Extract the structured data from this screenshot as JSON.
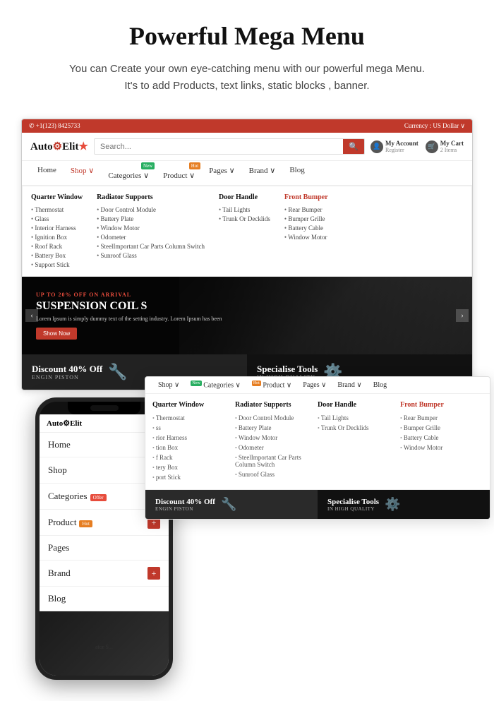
{
  "page": {
    "title": "Powerful Mega Menu",
    "subtitle_line1": "You can Create your own eye-catching menu with our powerful mega Menu.",
    "subtitle_line2": "It's to add Products, text links, static blocks , banner."
  },
  "topbar": {
    "phone": "✆ +1(123) 8425733",
    "currency": "Currency : US Dollar ∨"
  },
  "header": {
    "logo": "AutoElit",
    "search_placeholder": "Search...",
    "search_btn": "🔍",
    "account_label": "My Account",
    "register_label": "Register",
    "cart_label": "My Cart",
    "cart_count": "2 Items"
  },
  "desktop_nav": {
    "items": [
      {
        "label": "Home",
        "badge": ""
      },
      {
        "label": "Shop ∨",
        "badge": ""
      },
      {
        "label": "Categories ∨",
        "badge": "New"
      },
      {
        "label": "Product ∨",
        "badge": "Hot"
      },
      {
        "label": "Pages ∨",
        "badge": ""
      },
      {
        "label": "Brand ∨",
        "badge": ""
      },
      {
        "label": "Blog",
        "badge": ""
      }
    ]
  },
  "mega_menu": {
    "columns": [
      {
        "title": "Quarter Window",
        "title_color": "normal",
        "items": [
          "Thermostat",
          "Glass",
          "Interior Harness",
          "Ignition Box",
          "Roof Rack",
          "Battery Box",
          "Support Stick"
        ]
      },
      {
        "title": "Radiator Supports",
        "title_color": "normal",
        "items": [
          "Door Control Module",
          "Battery Plate",
          "Window Motor",
          "Odometer",
          "SteelImportant Car Parts Column Switch",
          "Sunroof Glass"
        ]
      },
      {
        "title": "Door Handle",
        "title_color": "normal",
        "items": [
          "Tail Lights",
          "Trunk Or Decklids"
        ]
      },
      {
        "title": "Front Bumper",
        "title_color": "red",
        "items": [
          "Rear Bumper",
          "Bumper Grille",
          "Battery Cable",
          "Window Motor"
        ]
      }
    ]
  },
  "hero": {
    "offer": "UP TO 20% OFF ON ARRIVAL",
    "title": "SUSPENSION COIL S",
    "text": "Lorem Ipsum is simply dummy text of the setting industry. Lorem Ipsum has been",
    "btn": "Show Now"
  },
  "promo_banners": [
    {
      "label": "Discount 40% Off",
      "sub": "ENGIN PISTON",
      "icon": "🔧"
    },
    {
      "label": "Specialise Tools",
      "sub": "IN HIGH QUALITY",
      "icon": "⚙️"
    }
  ],
  "mobile_nav": {
    "items": [
      {
        "label": "Home",
        "has_plus": false,
        "badge": ""
      },
      {
        "label": "Shop",
        "has_plus": true,
        "badge": ""
      },
      {
        "label": "Categories",
        "has_plus": true,
        "badge": "Offer"
      },
      {
        "label": "Product",
        "has_plus": true,
        "badge": "Hot"
      },
      {
        "label": "Pages",
        "has_plus": false,
        "badge": ""
      },
      {
        "label": "Brand",
        "has_plus": true,
        "badge": ""
      },
      {
        "label": "Blog",
        "has_plus": false,
        "badge": ""
      }
    ]
  },
  "overlay_nav": {
    "items": [
      {
        "label": "Shop ∨",
        "badge": ""
      },
      {
        "label": "Categories ∨",
        "badge": "New"
      },
      {
        "label": "Product ∨",
        "badge": "Hot"
      },
      {
        "label": "Pages ∨",
        "badge": ""
      },
      {
        "label": "Brand ∨",
        "badge": ""
      },
      {
        "label": "Blog",
        "badge": ""
      }
    ]
  },
  "overlay_mega": {
    "columns": [
      {
        "title": "Quarter Window",
        "items": [
          "Thermostat",
          "ss",
          "rior Harness",
          "tion Box",
          "f Rack",
          "tery Box",
          "port Stick"
        ]
      },
      {
        "title": "Radiator Supports",
        "items": [
          "Door Control Module",
          "Battery Plate",
          "Window Motor",
          "Odometer",
          "SteelImportant Car Parts Column Switch",
          "Sunroof Glass"
        ]
      },
      {
        "title": "Door Handle",
        "items": [
          "Tail Lights",
          "Trunk Or Decklids"
        ]
      },
      {
        "title": "Front Bumper",
        "title_color": "red",
        "items": [
          "Rear Bumper",
          "Bumper Grille",
          "Battery Cable",
          "Window Motor"
        ]
      }
    ]
  },
  "overlay_promos": [
    {
      "label": "Discount 40% Off",
      "sub": "ENGIN PISTON",
      "icon": "🔧"
    },
    {
      "label": "Specialise Tools",
      "sub": "IN HIGH QUALITY",
      "icon": "⚙️"
    }
  ]
}
